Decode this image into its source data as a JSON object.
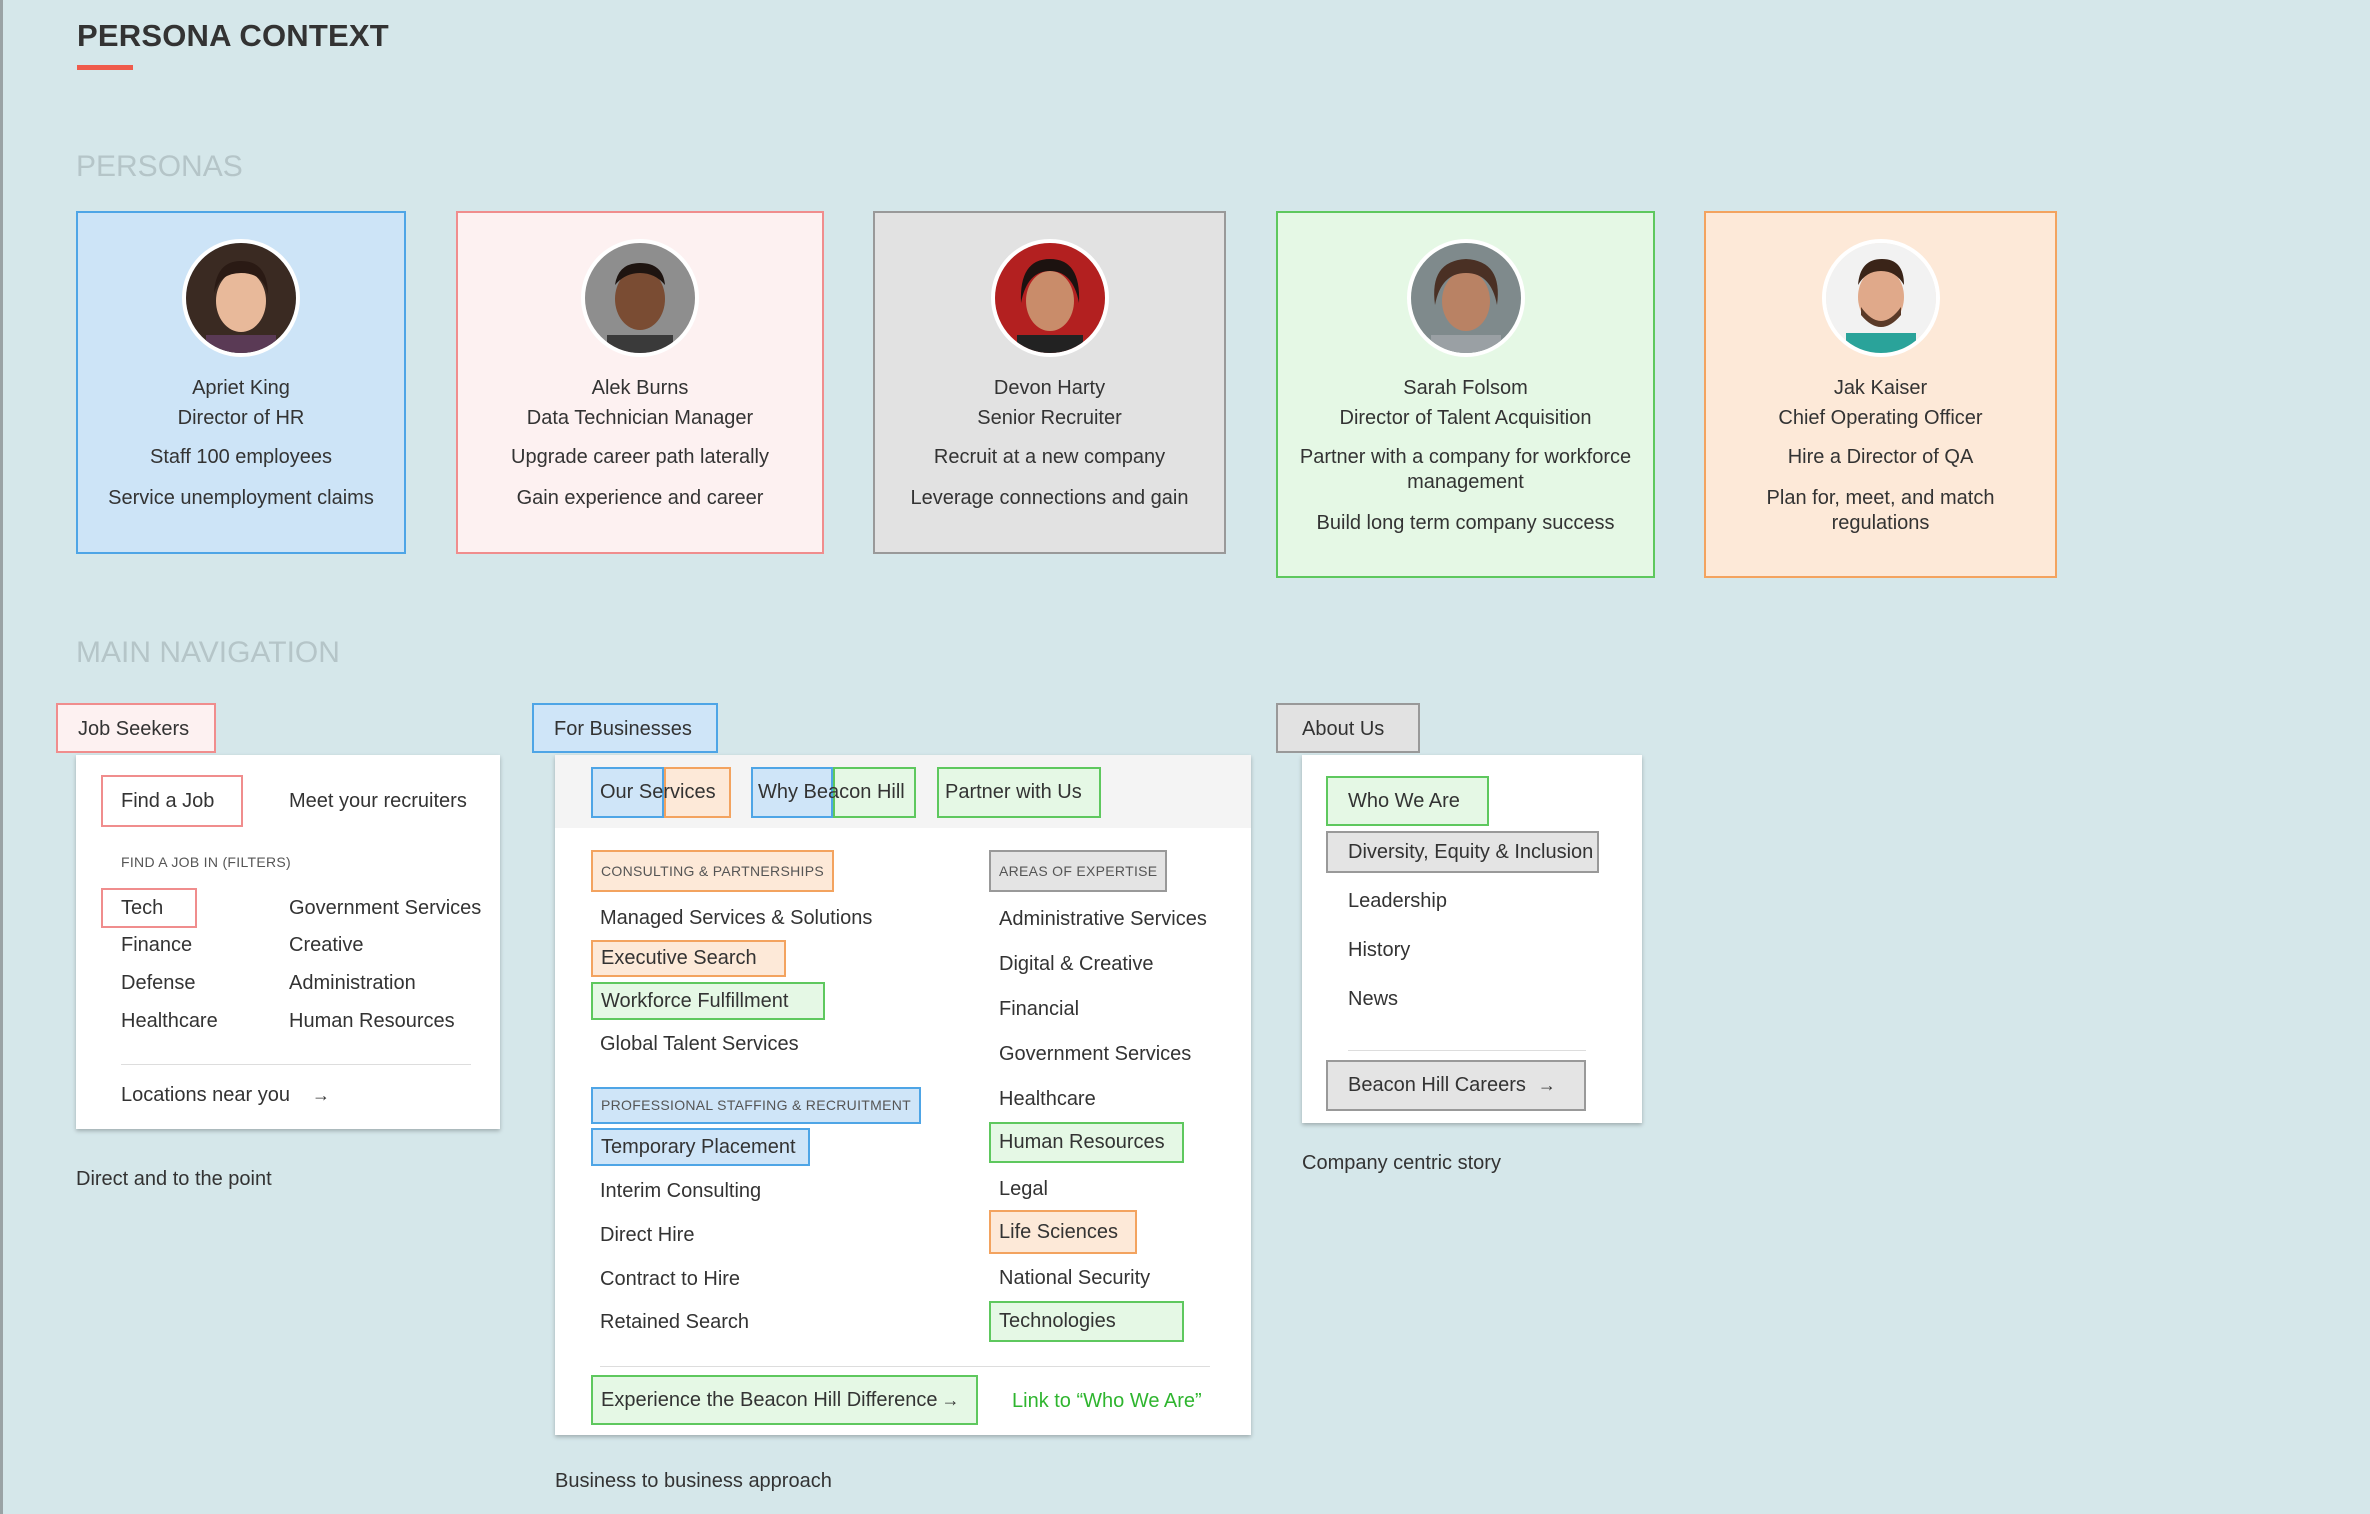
{
  "page": {
    "title": "PERSONA CONTEXT",
    "personas_heading": "PERSONAS",
    "nav_heading": "MAIN NAVIGATION"
  },
  "colors": {
    "background": "#d5e7ea",
    "blue": "#4ea5e6",
    "red": "#f08d8d",
    "gray": "#999999",
    "green": "#5ec85e",
    "orange": "#f3a35f",
    "accent": "#ef5b4c",
    "link_green": "#2fb52f"
  },
  "personas": [
    {
      "name": "Apriet King",
      "role": "Director of HR",
      "goal1": "Staff 100 employees",
      "goal2": "Service unemployment claims"
    },
    {
      "name": "Alek Burns",
      "role": "Data Technician Manager",
      "goal1": "Upgrade career path laterally",
      "goal2": "Gain experience and career"
    },
    {
      "name": "Devon Harty",
      "role": "Senior Recruiter",
      "goal1": "Recruit at a new company",
      "goal2": "Leverage connections and gain"
    },
    {
      "name": "Sarah Folsom",
      "role": "Director of Talent Acquisition",
      "goal1": "Partner with a company for workforce management",
      "goal2": "Build long term company success"
    },
    {
      "name": "Jak Kaiser",
      "role": "Chief Operating Officer",
      "goal1": "Hire a Director of QA",
      "goal2": "Plan for, meet, and match regulations"
    }
  ],
  "job_seekers": {
    "tab": "Job Seekers",
    "find_job": "Find a Job",
    "meet_recruiters": "Meet your recruiters",
    "filters_label": "FIND A JOB IN (FILTERS)",
    "filters_left": [
      "Tech",
      "Finance",
      "Defense",
      "Healthcare"
    ],
    "filters_right": [
      "Government Services",
      "Creative",
      "Administration",
      "Human Resources"
    ],
    "locations": "Locations near you",
    "arrow": "→",
    "caption": "Direct and to the point"
  },
  "businesses": {
    "tab": "For Businesses",
    "subtabs": [
      "Our Services",
      "Why Beacon Hill",
      "Partner with Us"
    ],
    "consulting_label": "CONSULTING & PARTNERSHIPS",
    "consulting_items": [
      "Managed Services & Solutions",
      "Executive Search",
      "Workforce Fulfillment",
      "Global Talent Services"
    ],
    "staffing_label": "PROFESSIONAL STAFFING & RECRUITMENT",
    "staffing_items": [
      "Temporary Placement",
      "Interim Consulting",
      "Direct Hire",
      "Contract to Hire",
      "Retained Search"
    ],
    "expertise_label": "AREAS OF EXPERTISE",
    "expertise_items": [
      "Administrative Services",
      "Digital & Creative",
      "Financial",
      "Government Services",
      "Healthcare",
      "Human Resources",
      "Legal",
      "Life Sciences",
      "National Security",
      "Technologies"
    ],
    "cta": "Experience the Beacon Hill Difference",
    "cta_arrow": "→",
    "cta_note": "Link to “Who We Are”",
    "caption": "Business to business approach"
  },
  "about": {
    "tab": "About Us",
    "items": [
      "Who We Are",
      "Diversity, Equity & Inclusion",
      "Leadership",
      "History",
      "News"
    ],
    "careers": "Beacon Hill Careers",
    "arrow": "→",
    "caption": "Company centric story"
  }
}
